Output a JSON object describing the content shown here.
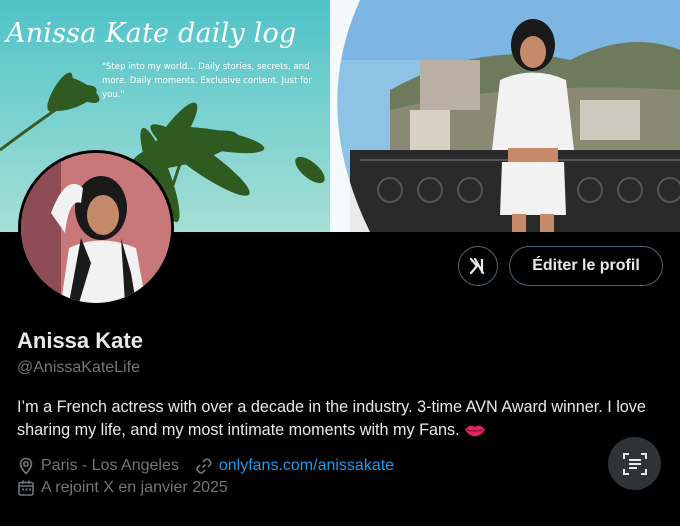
{
  "banner": {
    "title": "Anissa Kate daily log",
    "subtitle": "\"Step into my world... Daily stories, secrets, and more. Daily moments. Exclusive content. Just for you.\""
  },
  "actions": {
    "edit_profile_label": "Éditer le profil"
  },
  "profile": {
    "name": "Anissa Kate",
    "handle": "@AnissaKateLife",
    "bio": "I’m a French actress with over a decade in the industry. 3-time AVN Award winner. I love sharing my life, and my most intimate moments with my Fans.",
    "location": "Paris - Los Angeles",
    "website": "onlyfans.com/anissakate",
    "joined": "A rejoint X en janvier 2025"
  },
  "icons": {
    "x_logo": "x-logo-icon",
    "location": "location-pin-icon",
    "link": "link-icon",
    "calendar": "calendar-icon",
    "scan": "scan-text-icon",
    "lips": "lips-emoji-icon"
  },
  "colors": {
    "background": "#000000",
    "text": "#e7e9ea",
    "secondary": "#71767b",
    "link": "#1d9bf0",
    "border": "#536471"
  }
}
